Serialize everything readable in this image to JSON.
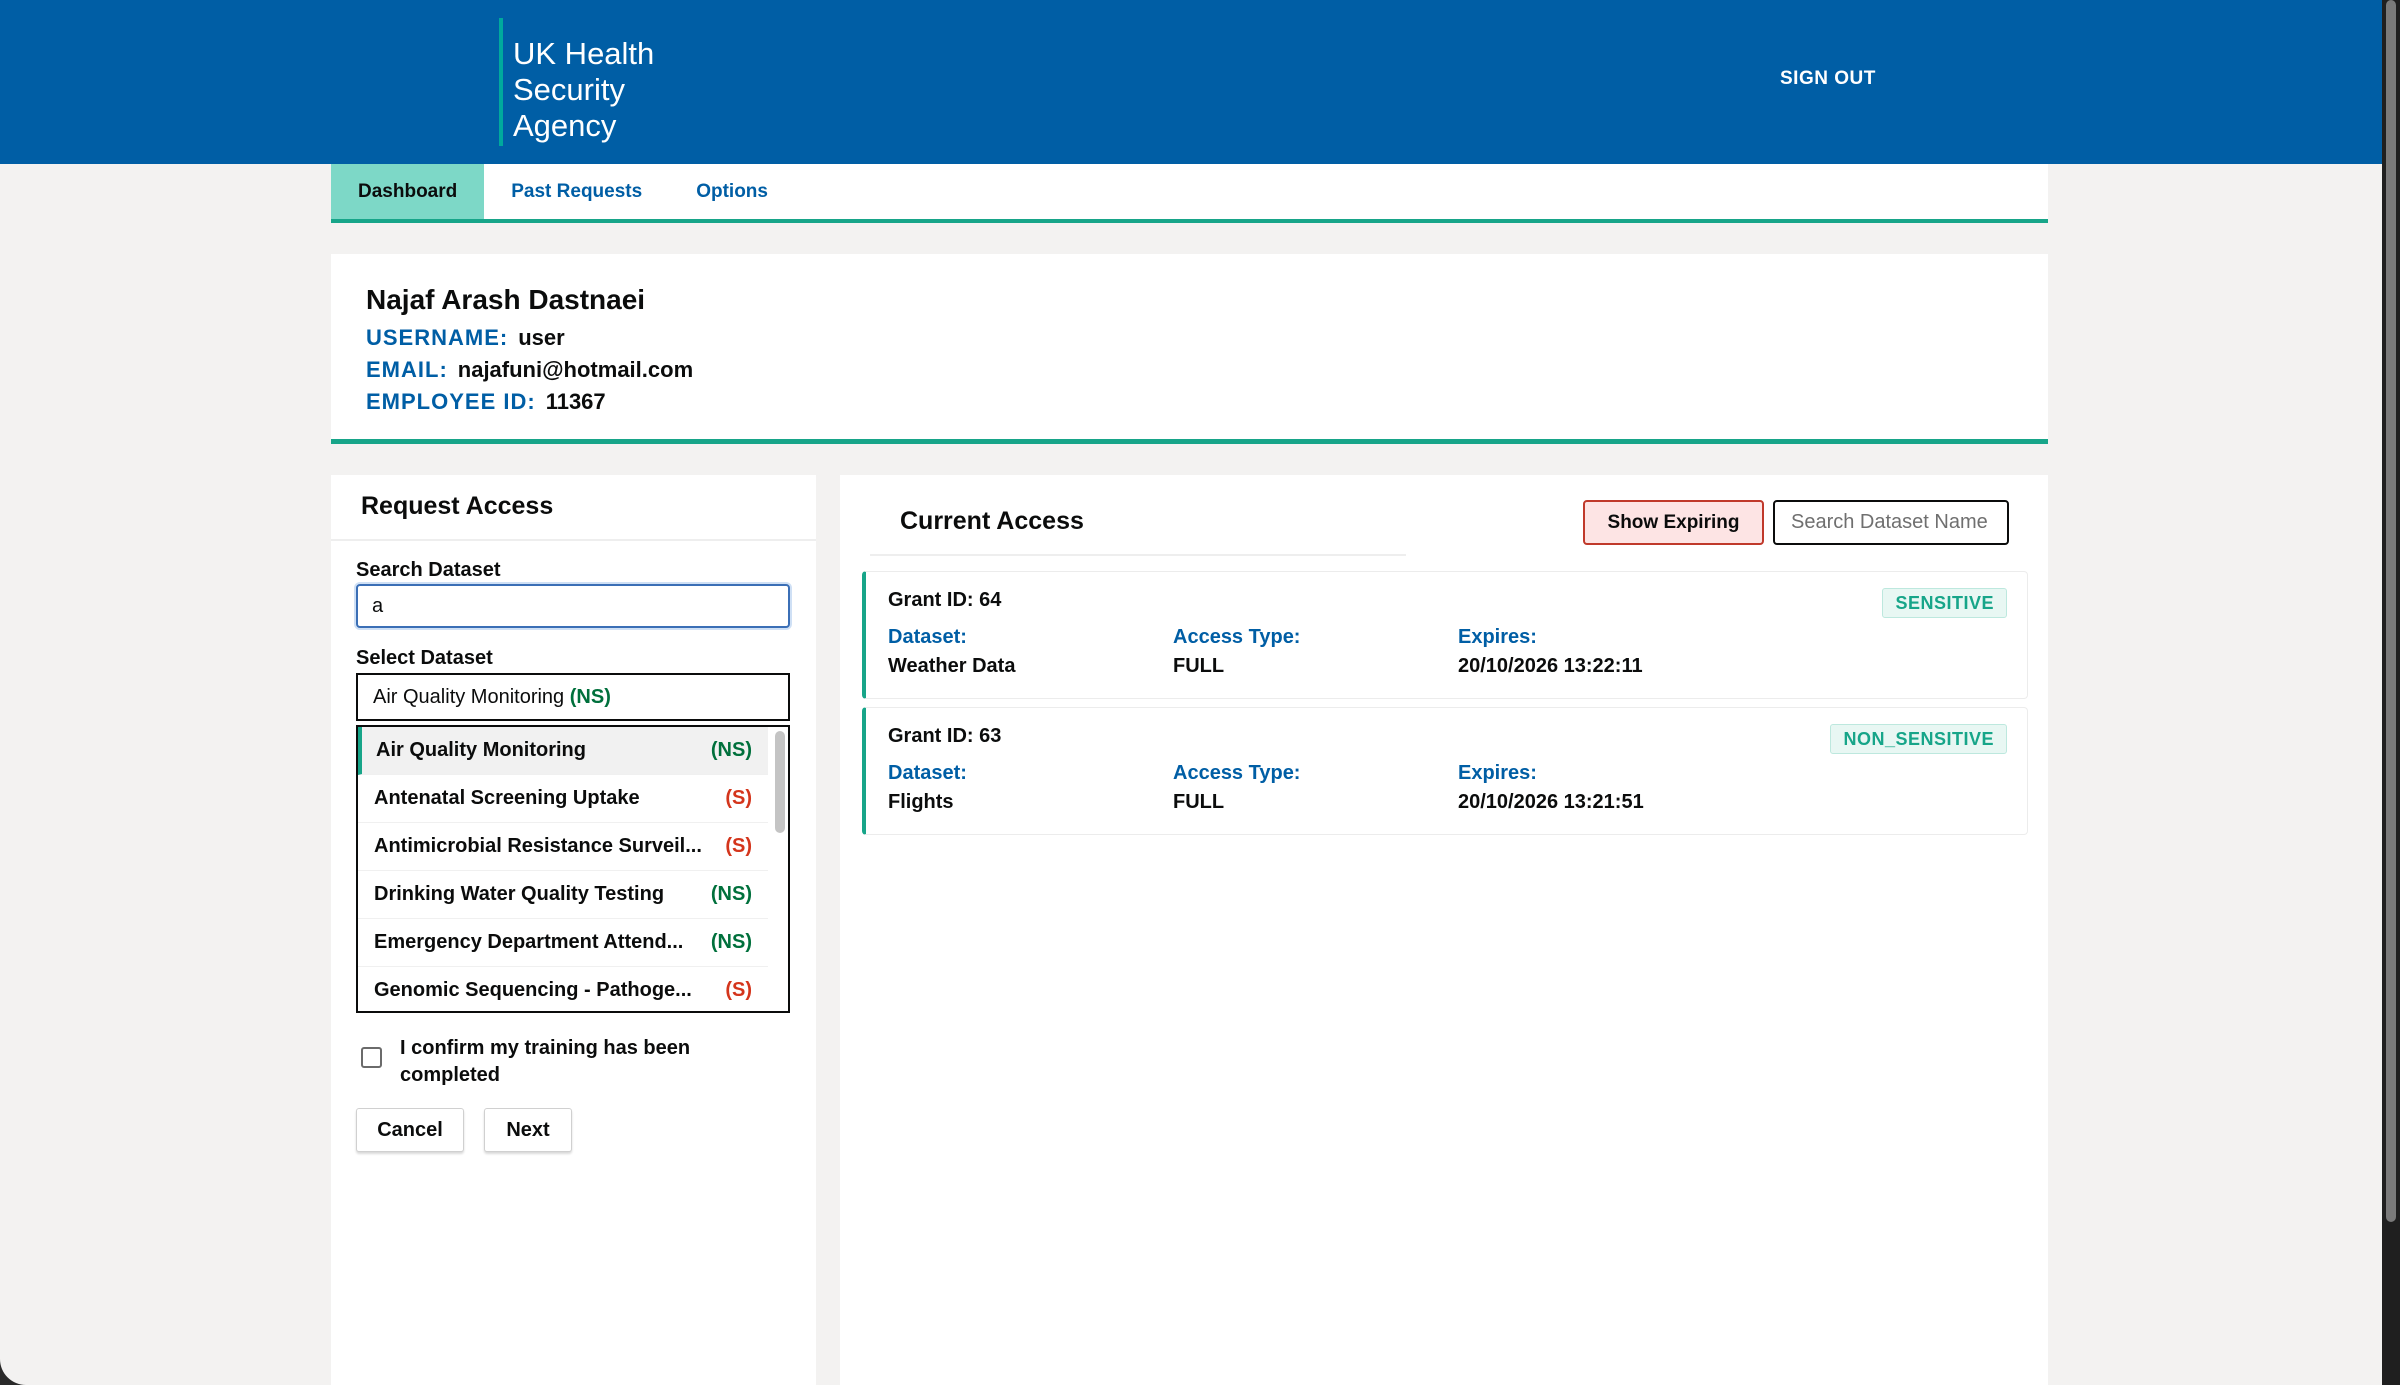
{
  "header": {
    "logo_lines": [
      "UK Health",
      "Security",
      "Agency"
    ],
    "sign_out": "SIGN OUT"
  },
  "tabs": [
    {
      "label": "Dashboard",
      "active": true
    },
    {
      "label": "Past Requests",
      "active": false
    },
    {
      "label": "Options",
      "active": false
    }
  ],
  "profile": {
    "name": "Najaf Arash Dastnaei",
    "username_label": "USERNAME:",
    "username": "user",
    "email_label": "EMAIL:",
    "email": "najafuni@hotmail.com",
    "employee_label": "EMPLOYEE ID:",
    "employee_id": "11367"
  },
  "request": {
    "title": "Request Access",
    "search_label": "Search Dataset",
    "search_value": "a",
    "select_label": "Select Dataset",
    "selected_name": "Air Quality Monitoring",
    "selected_tag": "(NS)",
    "options": [
      {
        "name": "Air Quality Monitoring",
        "tag": "(NS)"
      },
      {
        "name": "Antenatal Screening Uptake",
        "tag": "(S)"
      },
      {
        "name": "Antimicrobial Resistance Surveil...",
        "tag": "(S)"
      },
      {
        "name": "Drinking Water Quality Testing",
        "tag": "(NS)"
      },
      {
        "name": "Emergency Department Attend...",
        "tag": "(NS)"
      },
      {
        "name": "Genomic Sequencing - Pathoge...",
        "tag": "(S)"
      }
    ],
    "confirm_text": "I confirm my training has been completed",
    "confirm_checked": false,
    "cancel_label": "Cancel",
    "next_label": "Next"
  },
  "current": {
    "title": "Current Access",
    "show_expiring_label": "Show Expiring",
    "search_placeholder": "Search Dataset Name",
    "dataset_label": "Dataset:",
    "access_type_label": "Access Type:",
    "expires_label": "Expires:",
    "grants": [
      {
        "grant_id": "Grant ID: 64",
        "badge": "SENSITIVE",
        "dataset": "Weather Data",
        "access_type": "FULL",
        "expires": "20/10/2026 13:22:11"
      },
      {
        "grant_id": "Grant ID: 63",
        "badge": "NON_SENSITIVE",
        "dataset": "Flights",
        "access_type": "FULL",
        "expires": "20/10/2026 13:21:51"
      }
    ]
  },
  "colors": {
    "brand_blue": "#005ea5",
    "accent_teal": "#17a589",
    "ns_green": "#00703c",
    "s_red": "#d4351c"
  }
}
